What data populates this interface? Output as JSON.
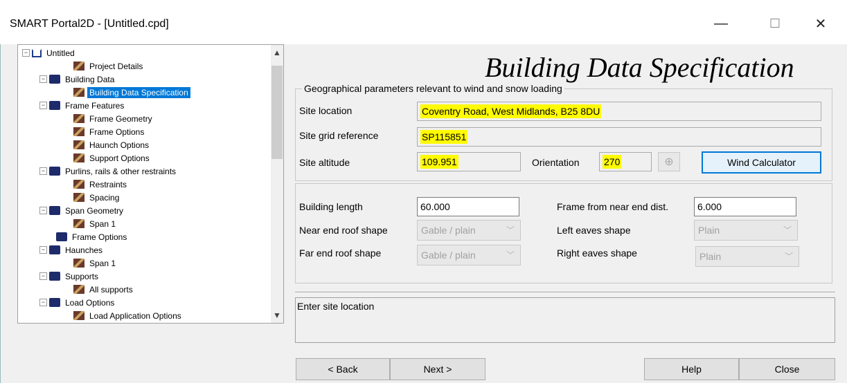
{
  "window": {
    "title": "SMART Portal2D - [Untitled.cpd]",
    "minimize": "—",
    "maximize": "☐",
    "close": "✕"
  },
  "tree": {
    "items": [
      {
        "label": "Untitled",
        "icon": "home-icon",
        "expander": "−"
      },
      {
        "label": "Project Details",
        "icon": "document-icon"
      },
      {
        "label": "Building Data",
        "icon": "folder-icon",
        "expander": "−"
      },
      {
        "label": "Building Data Specification",
        "icon": "document-icon",
        "selected": true
      },
      {
        "label": "Frame Features",
        "icon": "folder-icon",
        "expander": "−"
      },
      {
        "label": "Frame Geometry",
        "icon": "document-icon"
      },
      {
        "label": "Frame Options",
        "icon": "document-icon"
      },
      {
        "label": "Haunch Options",
        "icon": "document-icon"
      },
      {
        "label": "Support Options",
        "icon": "document-icon"
      },
      {
        "label": "Purlins, rails & other restraints",
        "icon": "folder-icon",
        "expander": "−"
      },
      {
        "label": "Restraints",
        "icon": "document-icon"
      },
      {
        "label": "Spacing",
        "icon": "document-icon"
      },
      {
        "label": "Span Geometry",
        "icon": "folder-icon",
        "expander": "−"
      },
      {
        "label": "Span 1",
        "icon": "document-icon"
      },
      {
        "label": "Frame Options",
        "icon": "folder-icon"
      },
      {
        "label": "Haunches",
        "icon": "folder-icon",
        "expander": "−"
      },
      {
        "label": "Span 1",
        "icon": "document-icon"
      },
      {
        "label": "Supports",
        "icon": "folder-icon",
        "expander": "−"
      },
      {
        "label": "All supports",
        "icon": "document-icon"
      },
      {
        "label": "Load Options",
        "icon": "folder-icon",
        "expander": "−"
      },
      {
        "label": "Load Application Options",
        "icon": "document-icon"
      }
    ]
  },
  "page": {
    "heading": "Building Data Specification"
  },
  "geo": {
    "group_title": "Geographical parameters relevant to wind and snow loading",
    "site_location_label": "Site location",
    "site_location_value": "Coventry Road, West Midlands, B25 8DU",
    "grid_ref_label": "Site grid reference",
    "grid_ref_value": "SP115851",
    "altitude_label": "Site altitude",
    "altitude_value": "109.951",
    "orientation_label": "Orientation",
    "orientation_value": "270",
    "wind_calc_button": "Wind Calculator"
  },
  "dims": {
    "building_length_label": "Building length",
    "building_length_value": "60.000",
    "frame_near_label": "Frame from near end dist.",
    "frame_near_value": "6.000",
    "near_roof_label": "Near end roof shape",
    "near_roof_value": "Gable / plain",
    "far_roof_label": "Far end roof shape",
    "far_roof_value": "Gable / plain",
    "left_eaves_label": "Left eaves shape",
    "left_eaves_value": "Plain",
    "right_eaves_label": "Right eaves shape",
    "right_eaves_value": "Plain"
  },
  "status": {
    "text": "Enter site location"
  },
  "footer": {
    "back": "< Back",
    "next": "Next >",
    "help": "Help",
    "close": "Close"
  },
  "colors": {
    "highlight": "#fffb00",
    "selection": "#0078d7"
  }
}
